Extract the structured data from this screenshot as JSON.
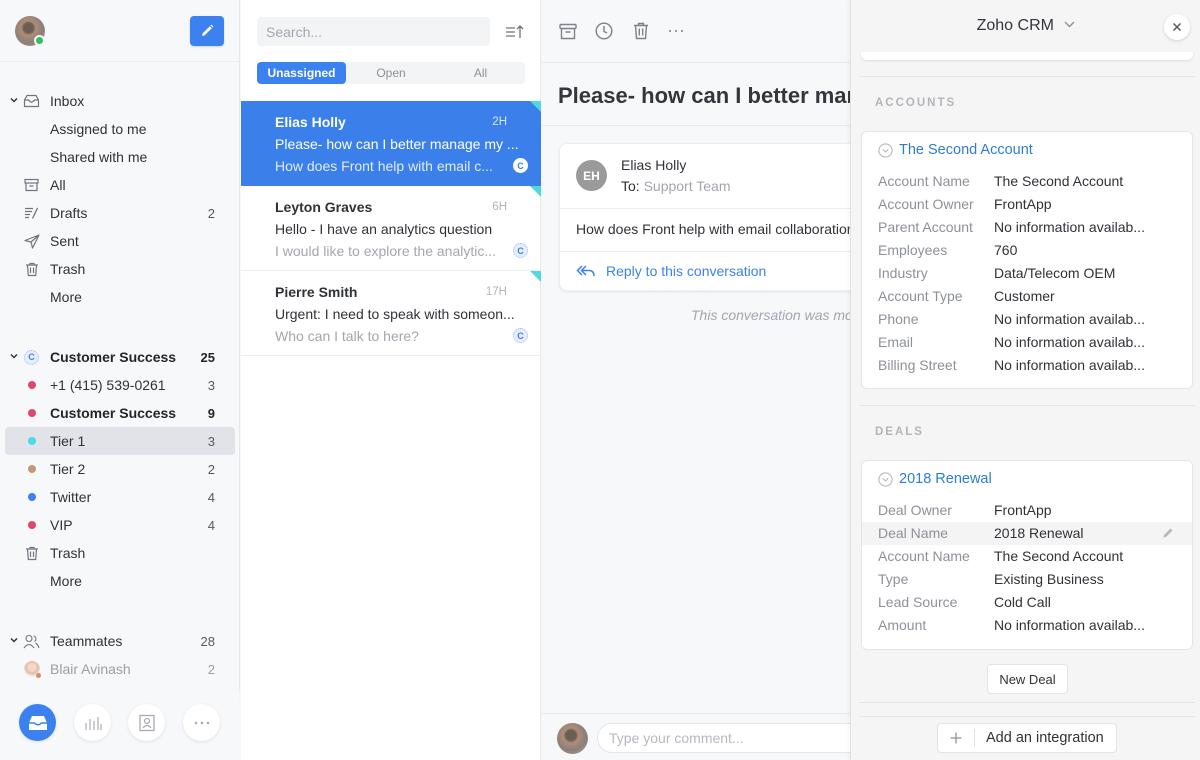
{
  "sidebar": {
    "compose_icon": "pencil-icon",
    "inbox": {
      "label": "Inbox",
      "items": [
        {
          "label": "Assigned to me"
        },
        {
          "label": "Shared with me"
        },
        {
          "label": "All",
          "icon": "archive-icon"
        },
        {
          "label": "Drafts",
          "icon": "drafts-icon",
          "count": "2"
        },
        {
          "label": "Sent",
          "icon": "send-icon"
        },
        {
          "label": "Trash",
          "icon": "trash-icon"
        },
        {
          "label": "More"
        }
      ]
    },
    "team_inbox": {
      "label": "Customer Success",
      "badge": "C",
      "count": "25",
      "items": [
        {
          "label": "+1 (415) 539-0261",
          "count": "3",
          "color": "#e0476d"
        },
        {
          "label": "Customer Success",
          "count": "9",
          "color": "#e0476d",
          "bold": true
        },
        {
          "label": "Tier 1",
          "count": "3",
          "color": "#4fd8e0",
          "selected": true
        },
        {
          "label": "Tier 2",
          "count": "2",
          "color": "#c4977a"
        },
        {
          "label": "Twitter",
          "count": "4",
          "color": "#3b82f0"
        },
        {
          "label": "VIP",
          "count": "4",
          "color": "#e0476d"
        },
        {
          "label": "Trash",
          "icon": "trash-icon"
        },
        {
          "label": "More"
        }
      ]
    },
    "teammates": {
      "label": "Teammates",
      "count": "28",
      "items": [
        {
          "label": "Blair Avinash",
          "count": "2"
        }
      ]
    },
    "bottom_buttons": [
      {
        "name": "inbox-icon",
        "active": true
      },
      {
        "name": "analytics-icon"
      },
      {
        "name": "contacts-icon"
      },
      {
        "name": "more-icon"
      }
    ]
  },
  "list": {
    "search_placeholder": "Search...",
    "tabs": [
      {
        "label": "Unassigned",
        "active": true
      },
      {
        "label": "Open"
      },
      {
        "label": "All"
      }
    ],
    "conversations": [
      {
        "from": "Elias Holly",
        "time": "2H",
        "subject": "Please- how can I better manage my ...",
        "preview": "How does Front help with email c...",
        "badge": "C",
        "selected": true
      },
      {
        "from": "Leyton Graves",
        "time": "6H",
        "subject": "Hello - I have an analytics question",
        "preview": "I would like to explore the analytic...",
        "badge": "C"
      },
      {
        "from": "Pierre Smith",
        "time": "17H",
        "subject": "Urgent: I need to speak with someon...",
        "preview": "Who can I talk to here?",
        "badge": "C"
      }
    ]
  },
  "message": {
    "toolbar": [
      "archive-icon",
      "snooze-clock-icon",
      "trash-icon",
      "more-icon"
    ],
    "title": "Please- how can I better manage my inbox?",
    "sender_initials": "EH",
    "sender": "Elias Holly",
    "to_label": "To:",
    "to_value": "Support Team",
    "body": "How does Front help with email collaboration?",
    "reply_label": "Reply to this conversation",
    "moved_note": "This conversation was moved",
    "comment_placeholder": "Type your comment..."
  },
  "crm": {
    "title": "Zoho CRM",
    "accounts_header": "ACCOUNTS",
    "account": {
      "name": "The Second Account",
      "fields": [
        {
          "label": "Account Name",
          "value": "The Second Account"
        },
        {
          "label": "Account Owner",
          "value": "FrontApp"
        },
        {
          "label": "Parent Account",
          "value": "No information availab..."
        },
        {
          "label": "Employees",
          "value": "760"
        },
        {
          "label": "Industry",
          "value": "Data/Telecom OEM"
        },
        {
          "label": "Account Type",
          "value": "Customer"
        },
        {
          "label": "Phone",
          "value": "No information availab..."
        },
        {
          "label": "Email",
          "value": "No information availab..."
        },
        {
          "label": "Billing Street",
          "value": "No information availab..."
        }
      ]
    },
    "deals_header": "DEALS",
    "deal": {
      "name": "2018 Renewal",
      "fields": [
        {
          "label": "Deal Owner",
          "value": "FrontApp"
        },
        {
          "label": "Deal Name",
          "value": "2018 Renewal",
          "editable": true
        },
        {
          "label": "Account Name",
          "value": "The Second Account"
        },
        {
          "label": "Type",
          "value": "Existing Business"
        },
        {
          "label": "Lead Source",
          "value": "Cold Call"
        },
        {
          "label": "Amount",
          "value": "No information availab..."
        }
      ]
    },
    "new_deal_label": "New Deal",
    "add_integration_label": "Add an integration"
  }
}
